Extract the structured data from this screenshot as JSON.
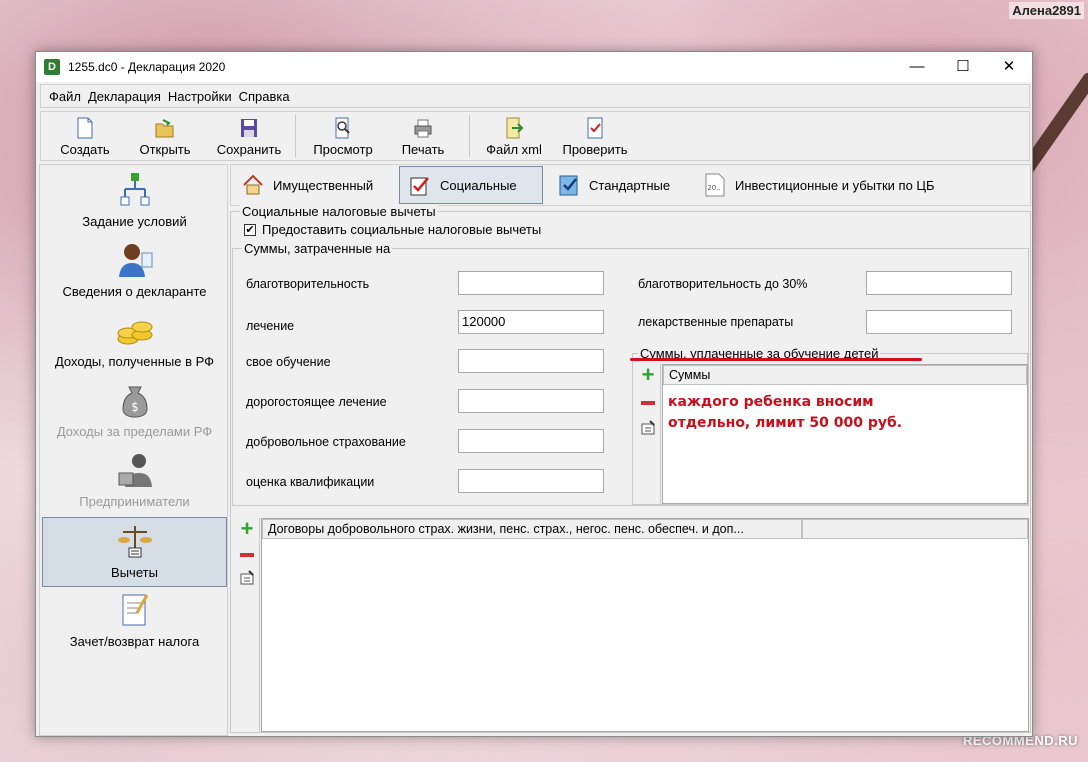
{
  "watermark": {
    "user": "Алена2891",
    "site": "RECOMMEND.RU"
  },
  "window": {
    "title": "1255.dc0 - Декларация 2020",
    "app_icon_letter": "D"
  },
  "window_controls": {
    "minimize": "—",
    "maximize": "☐",
    "close": "✕"
  },
  "menu": [
    "Файл",
    "Декларация",
    "Настройки",
    "Справка"
  ],
  "toolbar": {
    "create": "Создать",
    "open": "Открыть",
    "save": "Сохранить",
    "preview": "Просмотр",
    "print": "Печать",
    "file_xml": "Файл xml",
    "check": "Проверить"
  },
  "sidebar": [
    {
      "label": "Задание условий",
      "disabled": false,
      "active": false,
      "icon": "tree-icon"
    },
    {
      "label": "Сведения о декларанте",
      "disabled": false,
      "active": false,
      "icon": "person-icon"
    },
    {
      "label": "Доходы, полученные в РФ",
      "disabled": false,
      "active": false,
      "icon": "coins-icon"
    },
    {
      "label": "Доходы за пределами РФ",
      "disabled": true,
      "active": false,
      "icon": "money-bag-icon"
    },
    {
      "label": "Предприниматели",
      "disabled": true,
      "active": false,
      "icon": "entrepreneur-icon"
    },
    {
      "label": "Вычеты",
      "disabled": false,
      "active": true,
      "icon": "scales-icon"
    },
    {
      "label": "Зачет/возврат налога",
      "disabled": false,
      "active": false,
      "icon": "document-pen-icon"
    }
  ],
  "tabs": {
    "property": "Имущественный",
    "social": "Социальные",
    "standard": "Стандартные",
    "investment": "Инвестиционные и убытки по ЦБ",
    "investment_icon_text": "20.."
  },
  "social": {
    "group_title": "Социальные налоговые вычеты",
    "provide_checkbox_label": "Предоставить социальные налоговые вычеты",
    "provide_checked": true,
    "check_mark": "✔",
    "sums_title": "Суммы, затраченные на",
    "fields_left": [
      {
        "label": "благотворительность",
        "value": ""
      },
      {
        "label": "лечение",
        "value": "120000"
      },
      {
        "label": "свое обучение",
        "value": ""
      },
      {
        "label": "дорогостоящее лечение",
        "value": ""
      },
      {
        "label": "добровольное страхование",
        "value": ""
      },
      {
        "label": "оценка квалификации",
        "value": ""
      }
    ],
    "fields_right": [
      {
        "label": "благотворительность до 30%",
        "value": ""
      },
      {
        "label": "лекарственные препараты",
        "value": ""
      }
    ],
    "children_title": "Суммы, уплаченные за обучение детей",
    "children_col": "Суммы",
    "annotation_line1": "каждого ребенка вносим",
    "annotation_line2": "отдельно, лимит 50 000 руб.",
    "contracts_col": "Договоры добровольного страх. жизни, пенс. страх., негос. пенс. обеспеч. и доп..."
  },
  "colors": {
    "annotation": "#c8101a",
    "active_item_bg": "#d5dde7",
    "add_green": "#2fa12f",
    "remove_red": "#d03030"
  }
}
